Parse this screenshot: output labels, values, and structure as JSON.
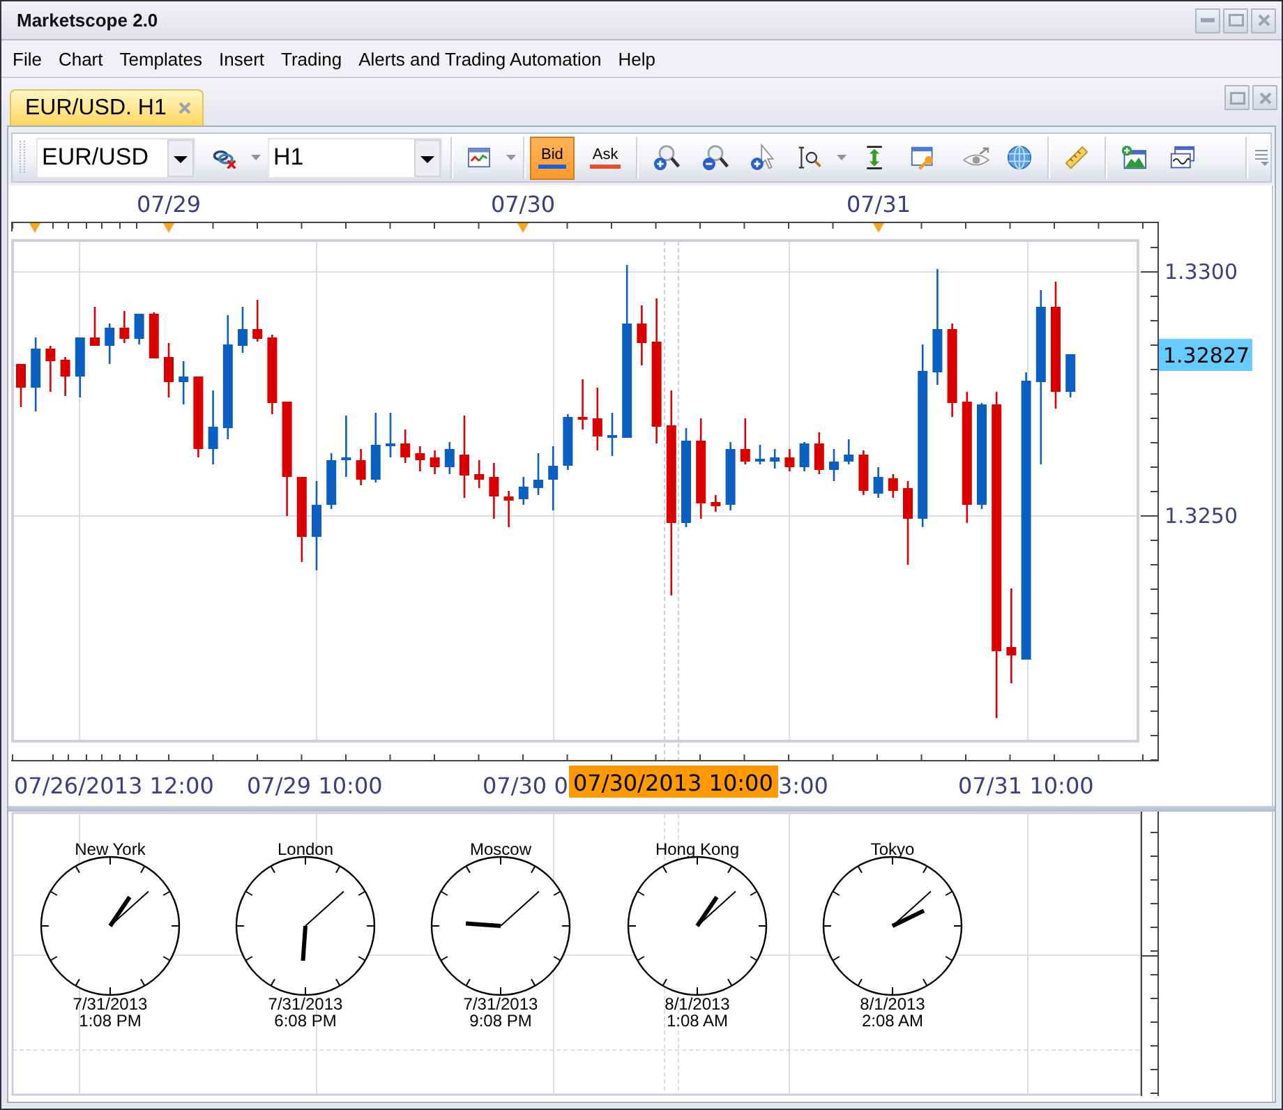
{
  "window": {
    "title": "Marketscope 2.0"
  },
  "menu": [
    "File",
    "Chart",
    "Templates",
    "Insert",
    "Trading",
    "Alerts and Trading Automation",
    "Help"
  ],
  "tabs": [
    {
      "label": "EUR/USD. H1",
      "selected": true
    }
  ],
  "toolbar": {
    "symbol": "EUR/USD",
    "timeframe": "H1",
    "price_modes": [
      {
        "label": "Bid",
        "selected": true
      },
      {
        "label": "Ask",
        "selected": false
      }
    ]
  },
  "chart": {
    "date_labels": [
      "07/29",
      "07/30",
      "07/31"
    ],
    "price_labels": [
      "1.3300",
      "1.3250"
    ],
    "current_price": "1.32827",
    "time_labels": [
      "07/26/2013 12:00",
      "07/29 10:00",
      "07/30 0",
      "3:00",
      "07/31 10:00"
    ],
    "cursor_time": "07/30/2013 10:00"
  },
  "clocks": [
    {
      "city": "New York",
      "date": "7/31/2013",
      "time": "1:08 PM"
    },
    {
      "city": "London",
      "date": "7/31/2013",
      "time": "6:08 PM"
    },
    {
      "city": "Moscow",
      "date": "7/31/2013",
      "time": "9:08 PM"
    },
    {
      "city": "Hong Kong",
      "date": "8/1/2013",
      "time": "1:08 AM"
    },
    {
      "city": "Tokyo",
      "date": "8/1/2013",
      "time": "2:08 AM"
    }
  ]
}
